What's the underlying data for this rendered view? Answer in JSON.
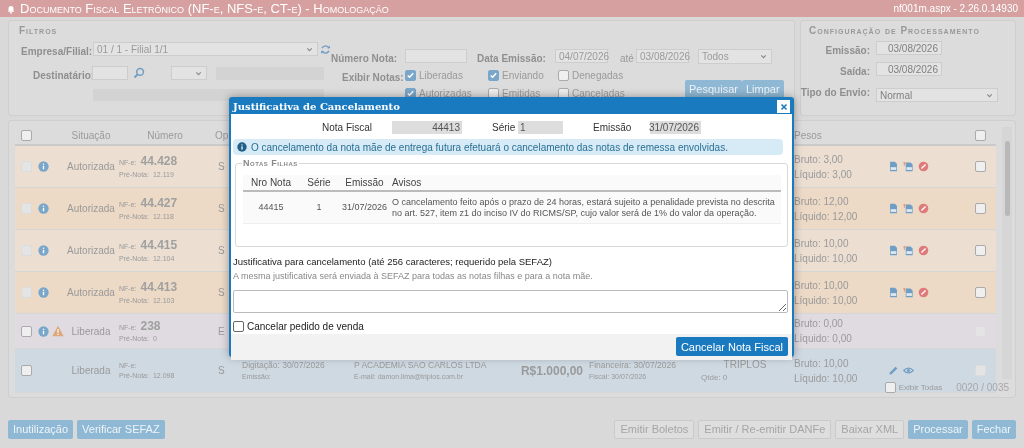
{
  "header": {
    "title": "Documento Fiscal Eletrônico (NF-e, NFS-e, CT-e)  - Homologação",
    "version": "nf001m.aspx - 2.26.0.14930"
  },
  "filters": {
    "legend": "Filtros",
    "empresa_label": "Empresa/Filial:",
    "empresa_value": "01 / 1 - Filial 1/1",
    "destinatario_label": "Destinatário:",
    "numero_label": "Número Nota:",
    "data_label": "Data Emissão:",
    "data_from": "04/07/2026",
    "ate_label": "até",
    "data_to": "03/08/2026",
    "status_value": "Todos",
    "exibir_label": "Exibir Notas:",
    "checkboxes": [
      {
        "label": "Liberadas",
        "checked": true
      },
      {
        "label": "Enviando",
        "checked": true
      },
      {
        "label": "Denegadas",
        "checked": false
      },
      {
        "label": "Autorizadas",
        "checked": true
      },
      {
        "label": "Emitidas",
        "checked": false
      },
      {
        "label": "Canceladas",
        "checked": false
      }
    ],
    "buttons": [
      "Pesquisar",
      "Limpar"
    ]
  },
  "config": {
    "legend": "Configuração de Processamento",
    "fields": [
      {
        "label": "Emissão:",
        "value": "03/08/2026",
        "kind": "date"
      },
      {
        "label": "Saída:",
        "value": "03/08/2026",
        "kind": "date"
      },
      {
        "label": "Tipo do Envio:",
        "value": "Normal",
        "kind": "select"
      }
    ]
  },
  "table": {
    "header_checked": false,
    "columns": [
      "Situação",
      "Número",
      "Op",
      "Pesos"
    ],
    "end_checked": false,
    "rows": [
      {
        "color": "#ecdfd2",
        "left_disabled": true,
        "right_disabled": false,
        "checked": false,
        "info": true,
        "warning": false,
        "situacao": "Autorizada",
        "nfe_label": "NF-e:",
        "nfe": "44.428",
        "pre_label": "Pré-Nota:",
        "pre": "12.119",
        "op": "S",
        "bruto": "Bruto: 3,00",
        "liquido": "Líquido: 3,00",
        "actions": [
          {
            "kind": "doc"
          },
          {
            "kind": "upload"
          },
          {
            "kind": "cancel"
          }
        ]
      },
      {
        "color": "#ecd9c6",
        "left_disabled": true,
        "right_disabled": false,
        "checked": false,
        "info": true,
        "warning": false,
        "situacao": "Autorizada",
        "nfe_label": "NF-e:",
        "nfe": "44.427",
        "pre_label": "Pré-Nota:",
        "pre": "12.118",
        "op": "S",
        "bruto": "Bruto: 12,00",
        "liquido": "Líquido: 12,00",
        "actions": [
          {
            "kind": "doc"
          },
          {
            "kind": "upload"
          },
          {
            "kind": "cancel"
          }
        ]
      },
      {
        "color": "#ecdfd2",
        "left_disabled": true,
        "right_disabled": false,
        "checked": false,
        "info": true,
        "warning": false,
        "situacao": "Autorizada",
        "nfe_label": "NF-e:",
        "nfe": "44.415",
        "pre_label": "Pré-Nota:",
        "pre": "12.104",
        "op": "S",
        "bruto": "Bruto: 10,00",
        "liquido": "Líquido: 10,00",
        "actions": [
          {
            "kind": "doc"
          },
          {
            "kind": "upload"
          },
          {
            "kind": "cancel"
          }
        ]
      },
      {
        "color": "#ecd9c6",
        "left_disabled": true,
        "right_disabled": false,
        "checked": false,
        "info": true,
        "warning": false,
        "situacao": "Autorizada",
        "nfe_label": "NF-e:",
        "nfe": "44.413",
        "pre_label": "Pré-Nota:",
        "pre": "12.103",
        "op": "S",
        "bruto": "Bruto: 10,00",
        "liquido": "Líquido: 10,00",
        "actions": [
          {
            "kind": "doc"
          },
          {
            "kind": "upload"
          },
          {
            "kind": "cancel"
          }
        ]
      },
      {
        "color": "#dfdbe0",
        "left_disabled": false,
        "right_disabled": true,
        "checked": false,
        "info": true,
        "warning": true,
        "situacao": "Liberada",
        "nfe_label": "NF-e:",
        "nfe": "238",
        "pre_label": "Pré-Nota:",
        "pre": "0",
        "op": "E",
        "bruto": "Bruto: 0,00",
        "liquido": "Líquido: 0,00"
      },
      {
        "color": "#cfd9e2",
        "left_disabled": false,
        "right_disabled": true,
        "checked": false,
        "info": false,
        "warning": false,
        "situacao": "Liberada",
        "nfe_label": "NF-e:",
        "pre_label": "Pré-Nota:",
        "pre": "12.098",
        "op": "S",
        "bruto": "Bruto: 10,00",
        "liquido": "Líquido: 10,00",
        "actions": [
          {
            "kind": "edit"
          },
          {
            "kind": "view"
          }
        ],
        "middle": [
          {
            "kind": "lines",
            "lines": [
              "Digitação: 30/07/2026",
              "Emissão:"
            ]
          },
          {
            "kind": "lines",
            "lines": [
              "P ACADEMIA SAO CARLOS LTDA",
              "E-mail: damon.lima@triplos.com.br"
            ]
          },
          {
            "kind": "amount",
            "lines": [
              "R$1.000,00"
            ]
          },
          {
            "kind": "lines",
            "lines": [
              "Financeira: 30/07/2026",
              "Fiscal: 30/07/2026"
            ]
          },
          {
            "kind": "center",
            "lines": [
              "TRIPLOS",
              "Qtde: 0"
            ]
          }
        ]
      }
    ]
  },
  "footer": {
    "exibir_todas": {
      "label": "Exibir Todas",
      "checked": false
    },
    "count": "0020 / 0035"
  },
  "bottom_left": [
    {
      "label": "Inutilização",
      "disabled": false
    },
    {
      "label": "Verificar SEFAZ",
      "disabled": false
    }
  ],
  "bottom_right": [
    {
      "label": "Emitir Boletos",
      "disabled": true
    },
    {
      "label": "Emitir / Re-emitir DANFe",
      "disabled": true
    },
    {
      "label": "Baixar XML",
      "disabled": true
    },
    {
      "label": "Processar",
      "disabled": false
    },
    {
      "label": "Fechar",
      "disabled": false
    }
  ],
  "modal": {
    "title": "Justificativa de Cancelamento",
    "fields": [
      {
        "label": "Nota Fiscal",
        "value": "44413"
      },
      {
        "label": "Série",
        "value": "1"
      },
      {
        "label": "Emissão",
        "value": "31/07/2026"
      }
    ],
    "info": "O cancelamento da nota mãe de entrega futura efetuará o cancelamento das notas de remessa envolvidas.",
    "notas_filhas": {
      "legend": "Notas Filhas",
      "columns": [
        "Nro Nota",
        "Série",
        "Emissão",
        "Avisos"
      ],
      "rows": [
        [
          "44415",
          "1",
          "31/07/2026",
          "O cancelamento feito após o prazo de 24 horas, estará sujeito a penalidade prevista no descrita no art. 527, item z1 do inciso IV do RICMS/SP, cujo valor será de 1% do valor da operação."
        ]
      ]
    },
    "justificativa_label": "Justificativa para cancelamento (até 256 caracteres; requerido pela SEFAZ)",
    "justificativa_hint": "A mesma justificativa será enviada à SEFAZ para todas as notas filhas e para a nota mãe.",
    "cancelar_pedido": {
      "label": "Cancelar pedido de venda",
      "checked": false
    },
    "button": "Cancelar Nota Fiscal"
  }
}
